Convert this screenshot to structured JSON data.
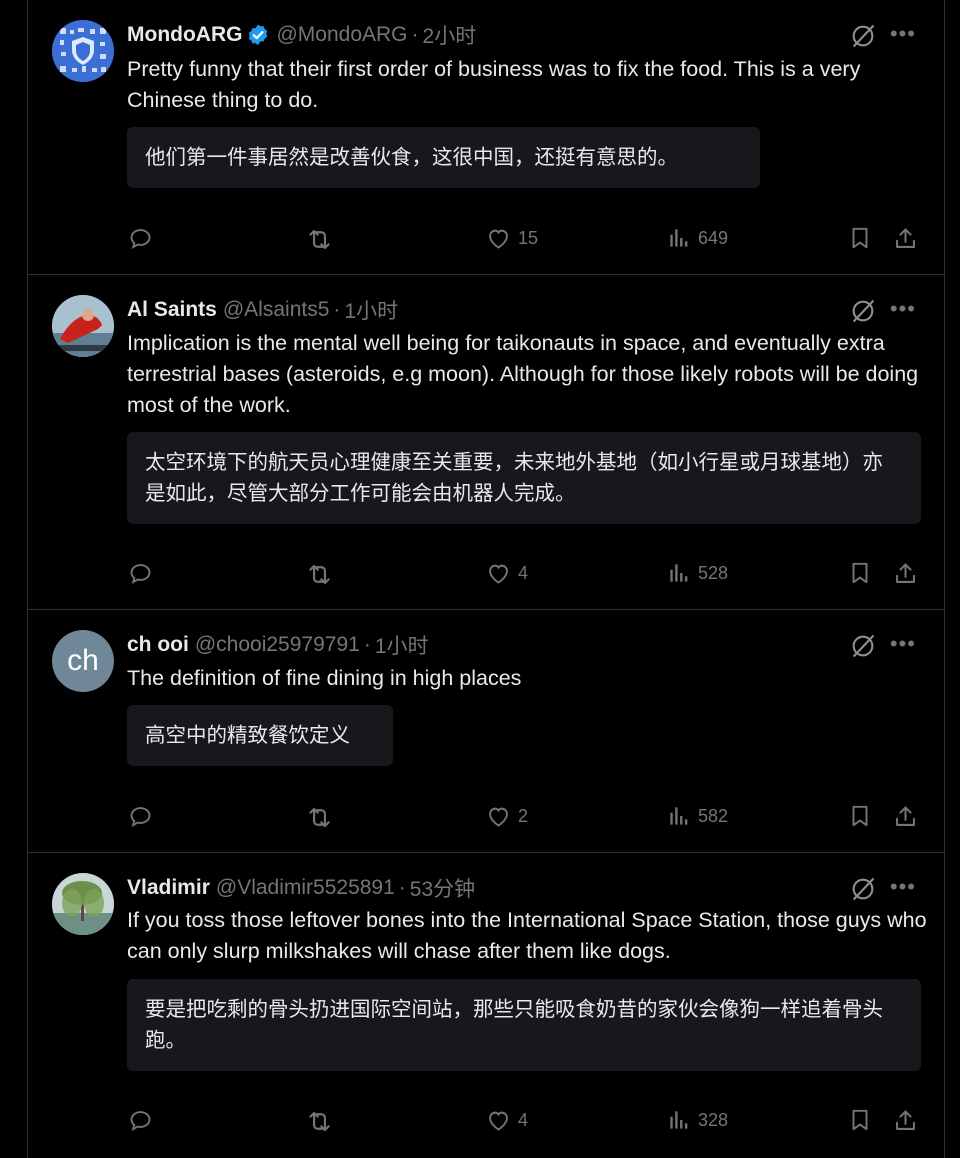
{
  "tweets": [
    {
      "name": "MondoARG",
      "verified": true,
      "handle": "@MondoARG",
      "time": "2小时",
      "text": "Pretty funny that their first order of business was to fix the food. This is a very Chinese thing to do.",
      "translation": "他们第一件事居然是改善伙食，这很中国，还挺有意思的。",
      "likes": "15",
      "views": "649"
    },
    {
      "name": "Al Saints",
      "verified": false,
      "handle": "@Alsaints5",
      "time": "1小时",
      "text": "Implication is the mental well being for taikonauts in space, and eventually extra terrestrial bases (asteroids, e.g moon).  Although for those likely robots will be doing most of the work.",
      "translation": "太空环境下的航天员心理健康至关重要，未来地外基地（如小行星或月球基地）亦是如此，尽管大部分工作可能会由机器人完成。",
      "likes": "4",
      "views": "528"
    },
    {
      "name": "ch ooi",
      "verified": false,
      "handle": "@chooi25979791",
      "time": "1小时",
      "avatar_text": "ch",
      "text": "The definition of fine dining in high places",
      "translation": "高空中的精致餐饮定义",
      "likes": "2",
      "views": "582"
    },
    {
      "name": "Vladimir",
      "verified": false,
      "handle": "@Vladimir5525891",
      "time": "53分钟",
      "text": "If you toss those leftover bones into the International Space Station, those guys who can only slurp milkshakes will chase after them like dogs.",
      "translation": "要是把吃剩的骨头扔进国际空间站，那些只能吸食奶昔的家伙会像狗一样追着骨头跑。",
      "likes": "4",
      "views": "328"
    }
  ],
  "separator": "·",
  "more_label": "•••",
  "colors": {
    "verified": "#1d9bf0",
    "muted": "#71767b",
    "background": "#000000",
    "card": "#16181c"
  }
}
